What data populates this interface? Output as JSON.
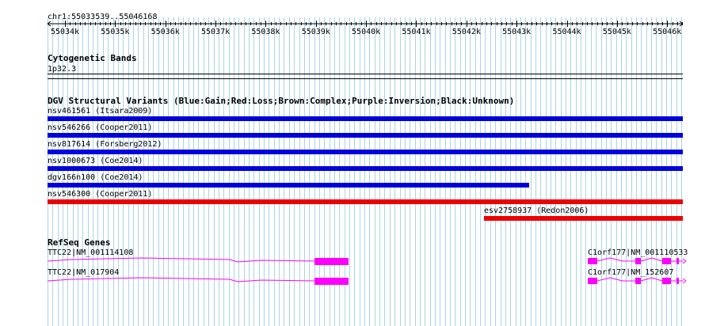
{
  "ruler": {
    "region": "chr1:55033539..55046168",
    "ticks": [
      "55034k",
      "55035k",
      "55036k",
      "55037k",
      "55038k",
      "55039k",
      "55040k",
      "55041k",
      "55042k",
      "55043k",
      "55044k",
      "55045k",
      "55046k"
    ]
  },
  "cytobands": {
    "title": "Cytogenetic Bands",
    "band": "1p32.3"
  },
  "dgv": {
    "title": "DGV Structural Variants (Blue:Gain;Red:Loss;Brown:Complex;Purple:Inversion;Black:Unknown)",
    "variants": [
      {
        "label": "nsv461561 (Itsara2009)",
        "color": "#0000dd",
        "type": "gain"
      },
      {
        "label": "nsv546266 (Cooper2011)",
        "color": "#0000dd",
        "type": "gain"
      },
      {
        "label": "nsv817614 (Forsberg2012)",
        "color": "#0000dd",
        "type": "gain"
      },
      {
        "label": "nsv1000673 (Coe2014)",
        "color": "#0000dd",
        "type": "gain"
      },
      {
        "label": "dgv166n100 (Coe2014)",
        "color": "#0000dd",
        "type": "gain"
      },
      {
        "label": "nsv546300 (Cooper2011)",
        "color": "#ee0000",
        "type": "loss"
      },
      {
        "label": "esv2758937 (Redon2006)",
        "color": "#ee0000",
        "type": "loss"
      }
    ]
  },
  "refseq": {
    "title": "RefSeq Genes",
    "genes": [
      {
        "label": "TTC22|NM_001114108",
        "color": "#ff00ff"
      },
      {
        "label": "TTC22|NM_017904",
        "color": "#ff00ff"
      },
      {
        "label": "C1orf177|NM_001110533",
        "color": "#ff00ff"
      },
      {
        "label": "C1orf177|NM_152607",
        "color": "#ff00ff"
      }
    ]
  },
  "colors": {
    "grid": "#aad4e6",
    "gain": "#0000dd",
    "loss": "#ee0000",
    "gene": "#ff00ff"
  }
}
